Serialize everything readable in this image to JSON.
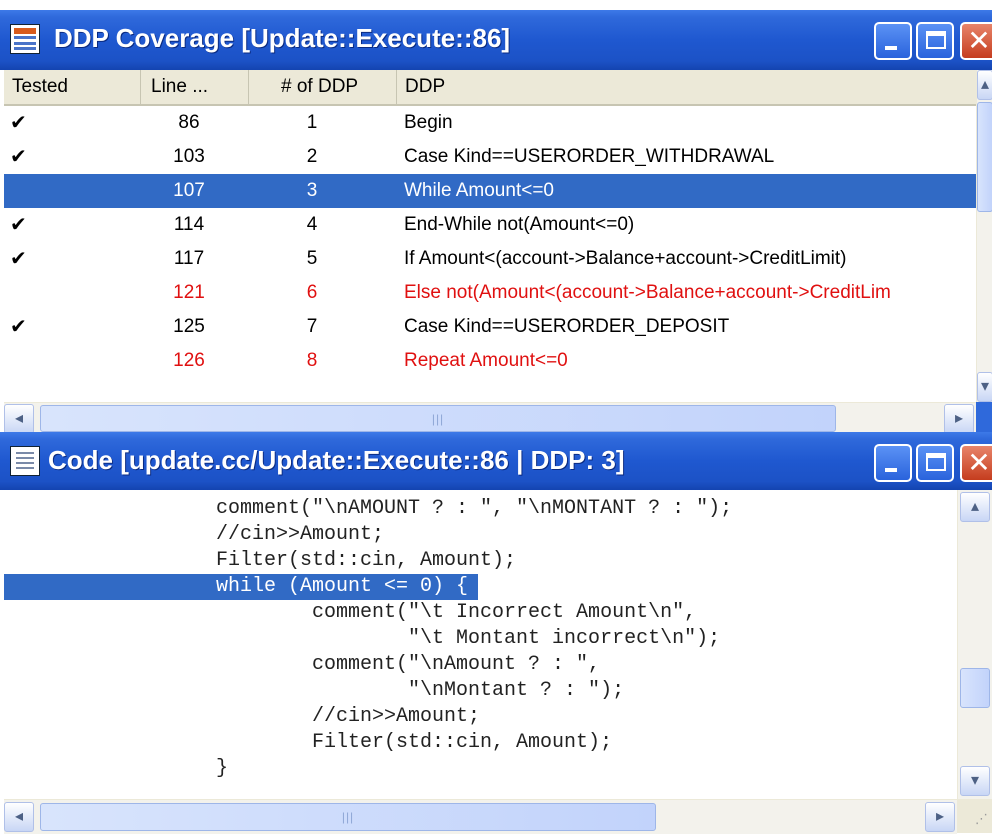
{
  "coverage_window": {
    "title": "DDP Coverage [Update::Execute::86]",
    "columns": [
      "Tested",
      "Line ...",
      "# of DDP",
      "DDP"
    ],
    "rows": [
      {
        "tested": "✔",
        "line": "86",
        "num": "1",
        "ddp": "Begin",
        "state": "normal"
      },
      {
        "tested": "✔",
        "line": "103",
        "num": "2",
        "ddp": "Case Kind==USERORDER_WITHDRAWAL",
        "state": "normal"
      },
      {
        "tested": "",
        "line": "107",
        "num": "3",
        "ddp": "While Amount<=0",
        "state": "selected"
      },
      {
        "tested": "✔",
        "line": "114",
        "num": "4",
        "ddp": "End-While not(Amount<=0)",
        "state": "normal"
      },
      {
        "tested": "✔",
        "line": "117",
        "num": "5",
        "ddp": "If Amount<(account->Balance+account->CreditLimit)",
        "state": "normal"
      },
      {
        "tested": "",
        "line": "121",
        "num": "6",
        "ddp": "Else not(Amount<(account->Balance+account->CreditLim",
        "state": "missed"
      },
      {
        "tested": "✔",
        "line": "125",
        "num": "7",
        "ddp": "Case Kind==USERORDER_DEPOSIT",
        "state": "normal"
      },
      {
        "tested": "",
        "line": "126",
        "num": "8",
        "ddp": "Repeat Amount<=0",
        "state": "missed"
      }
    ]
  },
  "code_window": {
    "title": "Code [update.cc/Update::Execute::86 | DDP: 3]",
    "lines": [
      "comment(\"\\nAMOUNT ? : \", \"\\nMONTANT ? : \");",
      "//cin>>Amount;",
      "Filter(std::cin, Amount);",
      "while (Amount <= 0) {",
      "        comment(\"\\t Incorrect Amount\\n\",",
      "                \"\\t Montant incorrect\\n\");",
      "        comment(\"\\nAmount ? : \",",
      "                \"\\nMontant ? : \");",
      "        //cin>>Amount;",
      "        Filter(std::cin, Amount);",
      "}"
    ],
    "highlighted_line_index": 3
  },
  "colors": {
    "title_bar": "#1f58d0",
    "selection": "#316ac5",
    "untested_text": "#e01010"
  }
}
